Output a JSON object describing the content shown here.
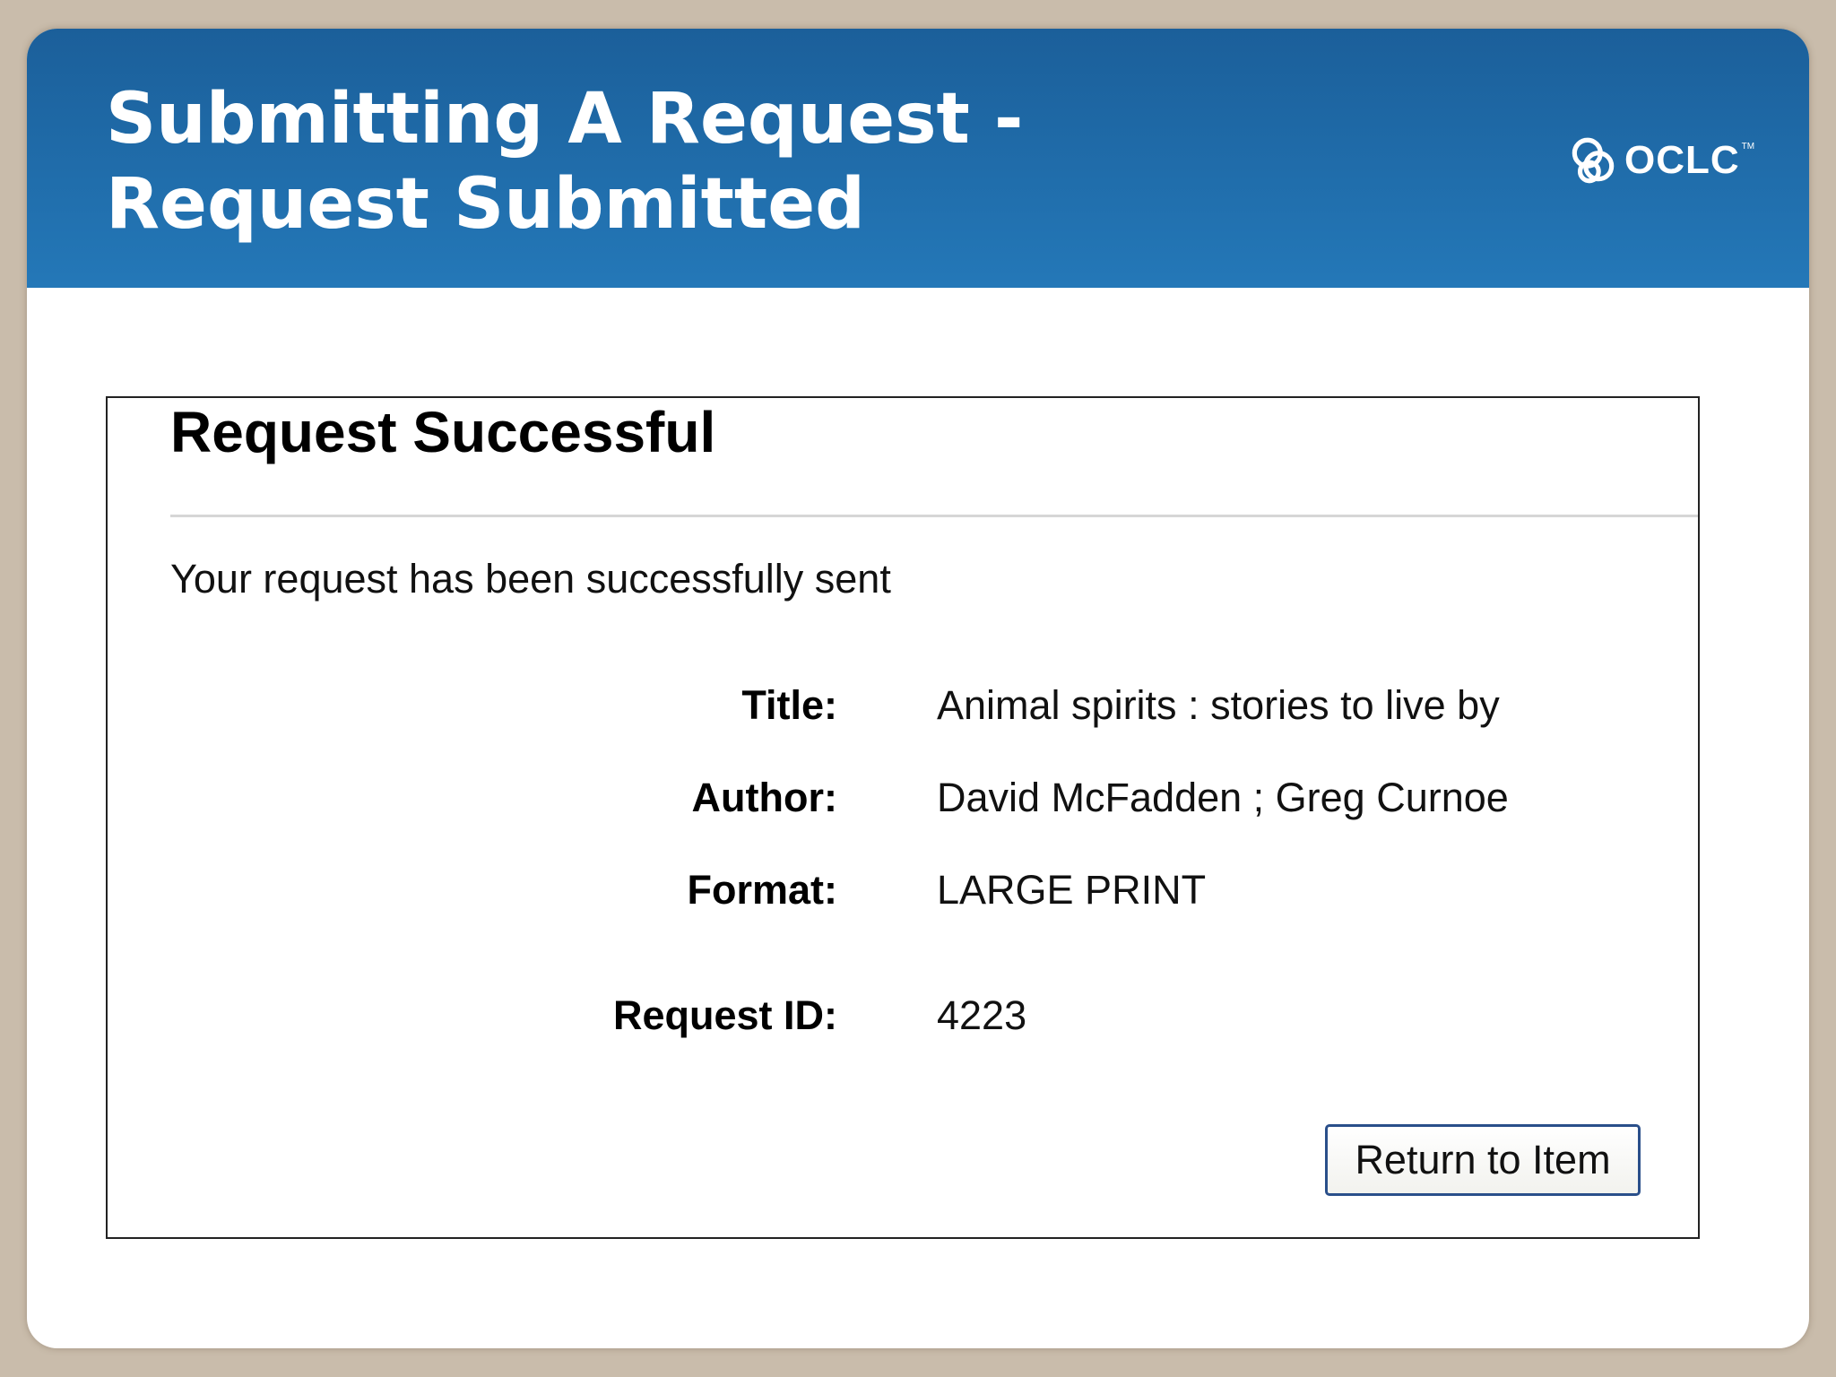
{
  "slide": {
    "title": "Submitting A Request - Request Submitted",
    "logo_text": "OCLC",
    "logo_tm": "TM",
    "logo_icon": "oclc-swirl-icon"
  },
  "panel": {
    "heading": "Request Successful",
    "message": "Your request has been successfully sent",
    "fields": [
      {
        "label": "Title:",
        "value": "Animal spirits : stories to live by"
      },
      {
        "label": "Author:",
        "value": "David McFadden ; Greg Curnoe"
      },
      {
        "label": "Format:",
        "value": "LARGE PRINT"
      },
      {
        "label": "Request ID:",
        "value": "4223"
      }
    ],
    "return_button_label": "Return to Item"
  },
  "colors": {
    "header_top": "#1b5f9a",
    "header_bottom": "#2478b8",
    "frame": "#c9bcab",
    "button_border": "#2a4f8a"
  }
}
